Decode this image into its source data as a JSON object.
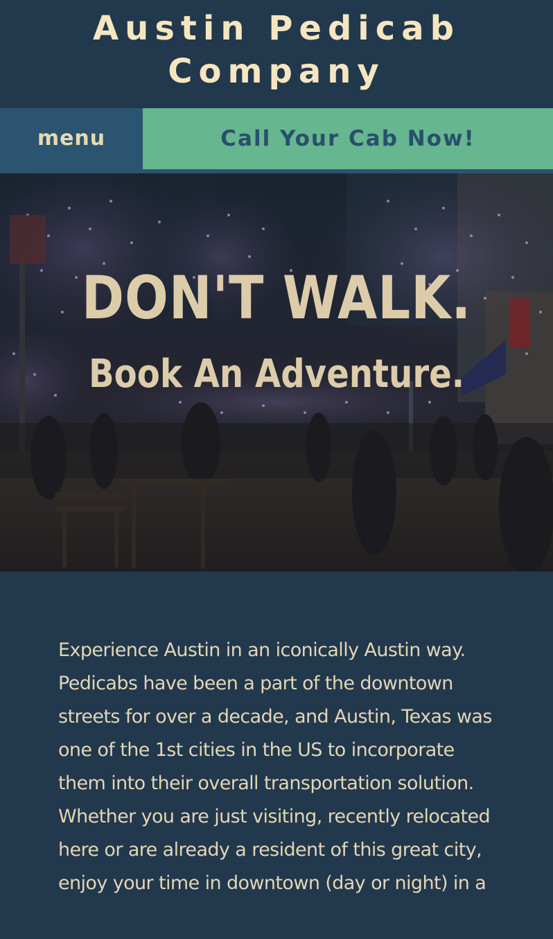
{
  "header": {
    "site_title": "Austin Pedicab Company"
  },
  "nav": {
    "menu_label": "menu",
    "call_label": "Call Your Cab Now!"
  },
  "hero": {
    "headline": "DON'T WALK.",
    "subline": "Book An Adventure."
  },
  "intro": {
    "text": "Experience Austin in an iconically Austin way. Pedicabs have been a part of the downtown streets for over a decade, and Austin, Texas was one of the 1st cities in the US to incorporate them into their overall transportation solution. Whether you are just visiting, recently relocated here or are already a resident of this great city, enjoy your time in downtown (day or night) in a"
  },
  "colors": {
    "background": "#22384c",
    "title_cream": "#f6e6c0",
    "menu_blue": "#2a5470",
    "call_green": "#66b68f",
    "hero_text": "#dcccaa"
  }
}
